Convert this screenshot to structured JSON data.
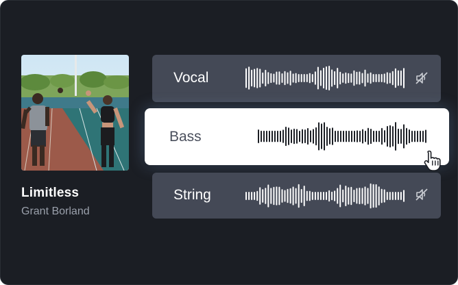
{
  "track": {
    "title": "Limitless",
    "artist": "Grant Borland"
  },
  "stems": [
    {
      "label": "Vocal",
      "state": "muted",
      "selected": false
    },
    {
      "label": "Bass",
      "state": "active",
      "selected": true
    },
    {
      "label": "String",
      "state": "muted",
      "selected": false
    }
  ],
  "icons": {
    "mute": "speaker-muted-icon",
    "cursor": "hand-pointer-icon"
  },
  "colors": {
    "background": "#1b1e24",
    "stem_row": "#444956",
    "stem_row_active": "#ffffff",
    "waveform_light": "#ffffff",
    "waveform_dark": "#1b1e24",
    "artist_text": "#9aa0ab"
  }
}
